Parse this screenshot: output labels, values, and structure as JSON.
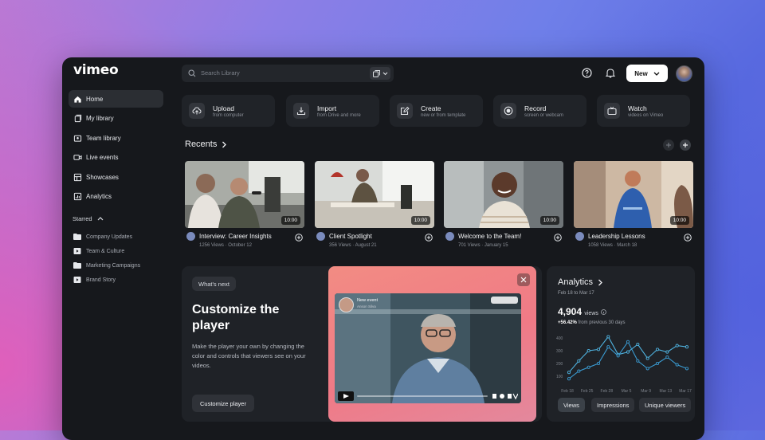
{
  "brand": {
    "logo_text": "vimeo"
  },
  "sidebar": {
    "items": [
      {
        "label": "Home",
        "icon": "home-icon",
        "active": true
      },
      {
        "label": "My library",
        "icon": "library-icon"
      },
      {
        "label": "Team library",
        "icon": "team-library-icon"
      },
      {
        "label": "Live events",
        "icon": "video-camera-icon"
      },
      {
        "label": "Showcases",
        "icon": "showcase-icon"
      },
      {
        "label": "Analytics",
        "icon": "analytics-icon"
      }
    ],
    "starred_label": "Starred",
    "starred": [
      {
        "label": "Company Updates",
        "icon": "folder-icon"
      },
      {
        "label": "Team & Culture",
        "icon": "video-icon"
      },
      {
        "label": "Marketing Campaigns",
        "icon": "folder-icon"
      },
      {
        "label": "Brand Story",
        "icon": "video-icon"
      }
    ]
  },
  "header": {
    "search_placeholder": "Search Library",
    "new_button": "New"
  },
  "quick_actions": [
    {
      "title": "Upload",
      "subtitle": "from computer",
      "icon": "upload-icon"
    },
    {
      "title": "Import",
      "subtitle": "from Drive and more",
      "icon": "import-icon"
    },
    {
      "title": "Create",
      "subtitle": "new or from template",
      "icon": "create-icon"
    },
    {
      "title": "Record",
      "subtitle": "screen or webcam",
      "icon": "record-icon"
    },
    {
      "title": "Watch",
      "subtitle": "videos on Vimeo",
      "icon": "tv-icon"
    }
  ],
  "recents": {
    "title": "Recents",
    "videos": [
      {
        "title": "Interview: Career Insights",
        "meta": "1256 Views · October 12",
        "duration": "10:00"
      },
      {
        "title": "Client Spotlight",
        "meta": "356 Views · August 21",
        "duration": "10:00"
      },
      {
        "title": "Welcome to the Team!",
        "meta": "701 Views · January 15",
        "duration": "10:00"
      },
      {
        "title": "Leadership Lessons",
        "meta": "1058 Views · March 18",
        "duration": "10:00"
      }
    ]
  },
  "promo": {
    "badge": "What's next",
    "title": "Customize the player",
    "description": "Make the player your own by changing the color and controls that viewers see on your videos.",
    "button": "Customize player",
    "preview_event_title": "New event",
    "preview_event_sub": "Anson Silva"
  },
  "analytics": {
    "title": "Analytics",
    "date_range": "Feb 18 to Mar 17",
    "views_value": "4,904",
    "views_label": "views",
    "delta_value": "+56.42%",
    "delta_text": "from previous 30 days",
    "tabs": [
      "Views",
      "Impressions",
      "Unique viewers"
    ],
    "chart": {
      "x": [
        "Feb 18",
        "Feb 25",
        "Feb 28",
        "Mar 5",
        "Mar 9",
        "Mar 13",
        "Mar 17"
      ],
      "y_ticks": [
        100,
        200,
        300,
        400
      ],
      "series": [
        {
          "values": [
            130,
            220,
            300,
            310,
            410,
            270,
            290,
            350,
            240,
            310,
            290,
            340,
            330
          ],
          "color": "#4fb3e0"
        },
        {
          "values": [
            80,
            140,
            170,
            200,
            330,
            260,
            370,
            220,
            160,
            200,
            250,
            190,
            160
          ],
          "color": "#3a9ad0"
        }
      ]
    }
  }
}
